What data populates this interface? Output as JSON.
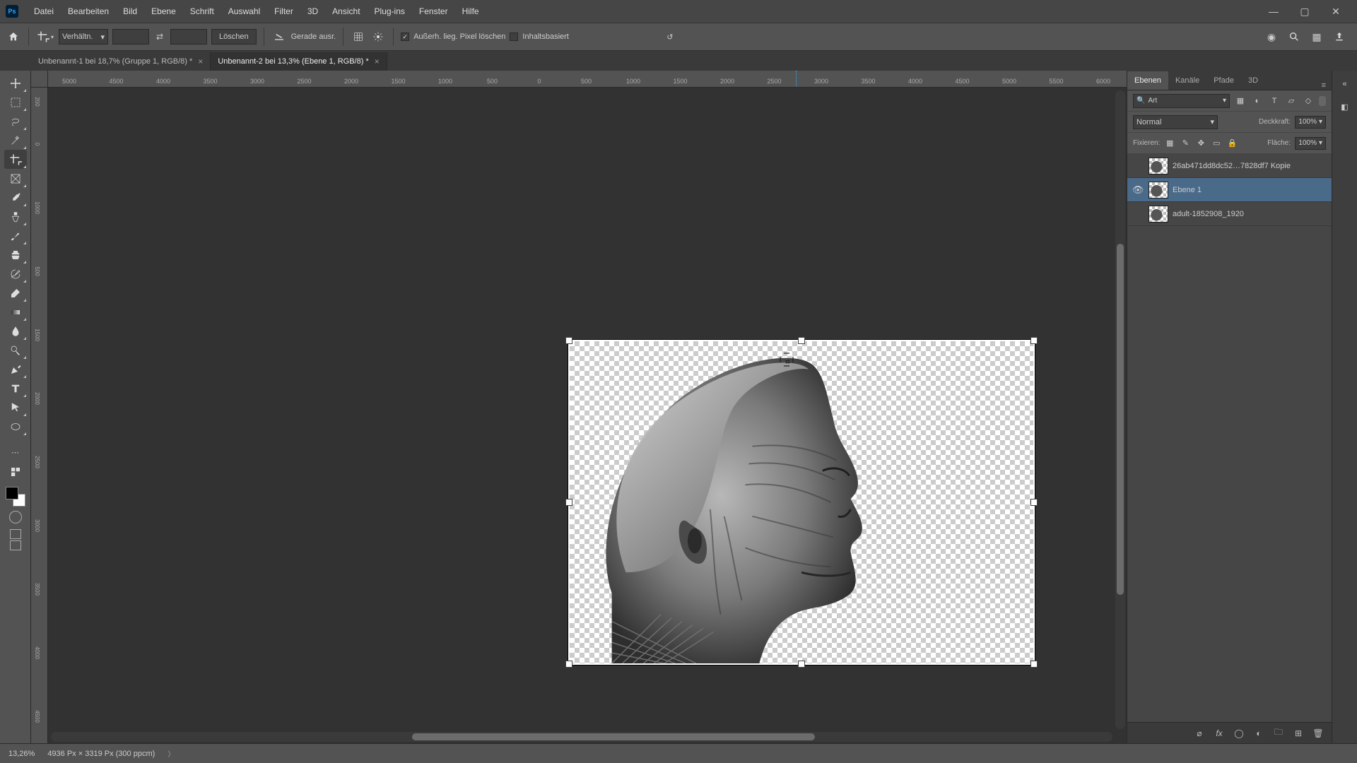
{
  "menu": [
    "Datei",
    "Bearbeiten",
    "Bild",
    "Ebene",
    "Schrift",
    "Auswahl",
    "Filter",
    "3D",
    "Ansicht",
    "Plug-ins",
    "Fenster",
    "Hilfe"
  ],
  "options": {
    "ratio_label": "Verhältn.",
    "clear_btn": "Löschen",
    "straighten": "Gerade ausr.",
    "delete_cropped": "Außerh. lieg. Pixel löschen",
    "content_aware": "Inhaltsbasiert"
  },
  "doc_tabs": [
    {
      "title": "Unbenannt-1 bei 18,7% (Gruppe 1, RGB/8) *",
      "active": false
    },
    {
      "title": "Unbenannt-2 bei 13,3% (Ebene 1, RGB/8) *",
      "active": true
    }
  ],
  "ruler_h": [
    "5000",
    "4500",
    "4000",
    "3500",
    "3000",
    "2500",
    "2000",
    "1500",
    "1000",
    "500",
    "0",
    "500",
    "1000",
    "1500",
    "2000",
    "2500",
    "3000",
    "3500",
    "4000",
    "4500",
    "5000",
    "5500",
    "6000"
  ],
  "ruler_v": [
    "2\n0\n0",
    "0",
    "1\n0\n0\n0",
    "5\n0\n0",
    "1\n5\n0\n0",
    "2\n0\n0\n0",
    "2\n5\n0\n0",
    "3\n0\n0\n0",
    "3\n5\n0\n0",
    "4\n0\n0\n0",
    "4\n5\n0\n0"
  ],
  "panels": {
    "tabs": [
      "Ebenen",
      "Kanäle",
      "Pfade",
      "3D"
    ],
    "search_placeholder": "Art",
    "blend_mode": "Normal",
    "opacity_label": "Deckkraft:",
    "opacity_value": "100%",
    "lock_label": "Fixieren:",
    "fill_label": "Fläche:",
    "fill_value": "100%"
  },
  "layers": [
    {
      "name": "26ab471dd8dc52…7828df7 Kopie",
      "visible": false,
      "selected": false
    },
    {
      "name": "Ebene 1",
      "visible": true,
      "selected": true
    },
    {
      "name": "adult-1852908_1920",
      "visible": false,
      "selected": false
    }
  ],
  "status": {
    "zoom": "13,26%",
    "docinfo": "4936 Px × 3319 Px (300 ppcm)"
  }
}
